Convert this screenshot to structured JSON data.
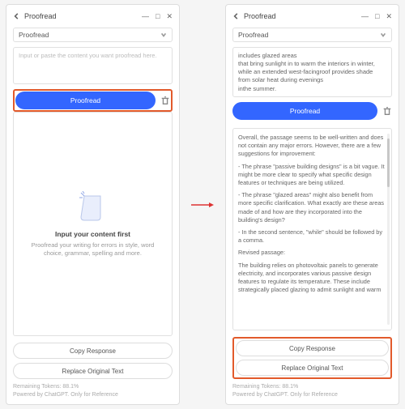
{
  "window": {
    "title": "Proofread",
    "min_icon": "—",
    "max_icon": "□",
    "close_icon": "✕"
  },
  "select": {
    "label": "Proofread"
  },
  "left": {
    "placeholder": "Input or paste the content you want proofread here.",
    "primary_button": "Proofread",
    "empty_title": "Input your content first",
    "empty_sub": "Proofread your writing for errors in style, word choice, grammar, spelling and more."
  },
  "right": {
    "input_text": "includes glazed areas\nthat bring sunlight in to warm the interiors in winter, while an extended west-facingroof provides shade from solar heat during evenings\ninthe summer.",
    "primary_button": "Proofread",
    "result_p1": "Overall, the passage seems to be well-written and does not contain any major errors. However, there are a few suggestions for improvement:",
    "result_b1": "- The phrase \"passive building designs\" is a bit vague. It might be more clear to specify what specific design features or techniques are being utilized.",
    "result_b2": "- The phrase \"glazed areas\" might also benefit from more specific clarification. What exactly are these areas made of and how are they incorporated into the building's design?",
    "result_b3": "- In the second sentence, \"while\" should be followed by a comma.",
    "result_rev_label": "Revised passage:",
    "result_rev": "The building relies on photovoltaic panels to generate electricity, and incorporates various passive design features to regulate its temperature. These include strategically placed glazing to admit sunlight and warm"
  },
  "buttons": {
    "copy": "Copy Response",
    "replace": "Replace Original Text"
  },
  "footer": {
    "tokens": "Remaining Tokens: 88.1%",
    "powered": "Powered by ChatGPT. Only for Reference"
  }
}
